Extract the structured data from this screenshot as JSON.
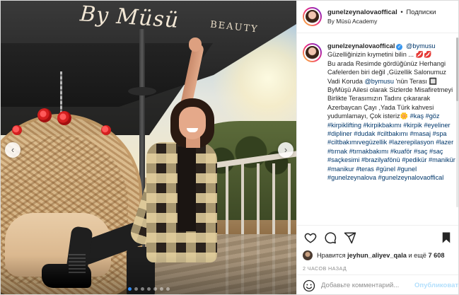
{
  "photo": {
    "logo_script": "By Müsü",
    "logo_word": "BEAUTY",
    "carousel": {
      "current": 1,
      "total": 7,
      "left_arrow": "‹",
      "right_arrow": "›"
    }
  },
  "header": {
    "username": "gunelzeynalovaoffical",
    "separator": "•",
    "follow_label": "Подписки",
    "location": "By Müsü Academy"
  },
  "caption": {
    "username": "gunelzeynalovaoffical",
    "verified_mark": "✓",
    "mention_head": "@bymusu",
    "line1": "Güzelliğinizin kıymetini bilin ... 💋💋",
    "text_a": "Bu arada Resimde gördüğünüz Herhangi Cafelerden biri değil ,Güzellik Salonumuz Vadi Koruda ",
    "mention_mid": "@bymusu",
    "text_b": " 'nün Terası 🔲 ByMüşü Ailesi olarak Sizlerde Misafiretmeyi Birlikte Terasımızın Tadını çıkararak Azerbaycan Çayı ,Yada Türk kahvesi yudumlamayı, Çok isteriz🌼 ",
    "hashtags": "#kaş #göz #kirpiklifting #kirpikbakımı #kirpik #eyeliner #dipliner #dudak #ciltbakımı #masaj #spa #ciltbakımıvegüzellik #lazerepilasyon #lazer #tırnak #tırnakbakımı #kuaför #saç #saç #saçkesimi #brazilyafönü #pedikür #manikür #manikur #teras #günel #gunel #gunelzeynalova #gunelzeynalovaoffical"
  },
  "likes": {
    "prefix": "Нравится",
    "user": "jeyhun_aliyev_qala",
    "middle": "и ещё",
    "count": "7 608"
  },
  "timestamp": "2 ЧАСОВ НАЗАД",
  "comment": {
    "placeholder": "Добавьте комментарий...",
    "publish": "Опубликовать"
  },
  "icons": [
    "heart-icon",
    "comment-icon",
    "share-icon",
    "bookmark-icon",
    "smile-icon"
  ],
  "colors": {
    "link": "#00376b",
    "verified": "#3897f0",
    "publish": "#b2dffc",
    "muted": "#8e8e8e",
    "dot_active": "#2f8bf5"
  }
}
